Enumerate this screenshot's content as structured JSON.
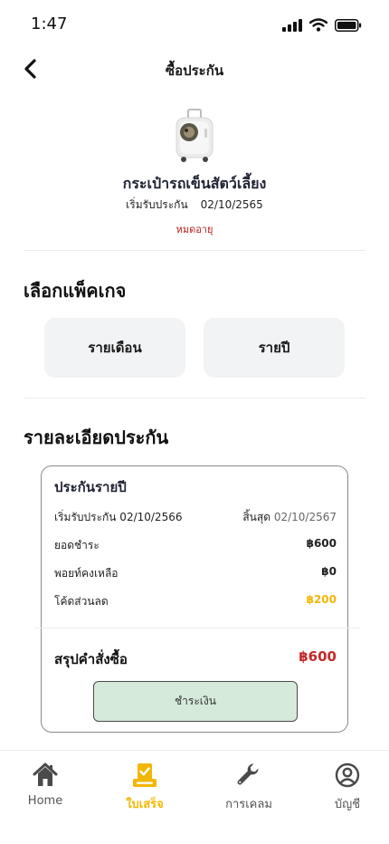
{
  "status_bar": {
    "time": "1:47"
  },
  "header": {
    "title": "ซื้อประกัน"
  },
  "product": {
    "name": "กระเป๋ารถเข็นสัตว์เลี้ยง",
    "start_label": "เริ่มรับประกัน",
    "start_date": "02/10/2565",
    "status": "หมดอายุ"
  },
  "package_section": {
    "title": "เลือกแพ็คเกจ",
    "options": [
      "รายเดือน",
      "รายปี"
    ]
  },
  "details_section": {
    "title": "รายละเอียดประกัน",
    "card": {
      "title": "ประกันรายปี",
      "start": "เริ่มรับประกัน 02/10/2566",
      "end_label": "สิ้นสุด",
      "end_date": "02/10/2567",
      "rows": [
        {
          "label": "ยอดชำระ",
          "value": "฿600"
        },
        {
          "label": "พอยท์คงเหลือ",
          "value": "฿0"
        },
        {
          "label": "โค้ดส่วนลด",
          "value": "฿200"
        }
      ],
      "summary_label": "สรุปคำสั่งซื้อ",
      "summary_value": "฿600",
      "pay_label": "ชำระเงิน"
    }
  },
  "tabs": [
    {
      "label": "Home",
      "icon": "home-icon"
    },
    {
      "label": "ใบเสร็จ",
      "icon": "receipt-icon",
      "active": true
    },
    {
      "label": "การเคลม",
      "icon": "wrench-icon"
    },
    {
      "label": "บัญชี",
      "icon": "account-icon"
    }
  ],
  "colors": {
    "accent": "#F2B705",
    "danger": "#C62828",
    "pay_button": "#D5EAD9"
  }
}
